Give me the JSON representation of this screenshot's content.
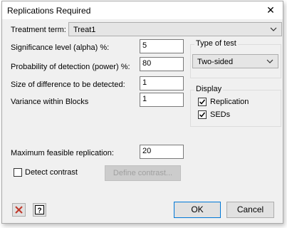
{
  "window": {
    "title": "Replications Required"
  },
  "treatment": {
    "label": "Treatment term:",
    "value": "Treat1"
  },
  "fields": {
    "alpha": {
      "label": "Significance level (alpha) %:",
      "value": "5"
    },
    "power": {
      "label": "Probability of detection (power) %:",
      "value": "80"
    },
    "difference": {
      "label": "Size of difference to be detected:",
      "value": "1"
    },
    "variance": {
      "label": "Variance within Blocks",
      "value": "1"
    },
    "max_rep": {
      "label": "Maximum feasible replication:",
      "value": "20"
    }
  },
  "test_type": {
    "group_label": "Type of test",
    "value": "Two-sided"
  },
  "display": {
    "group_label": "Display",
    "replication": {
      "label": "Replication",
      "checked": true
    },
    "seds": {
      "label": "SEDs",
      "checked": true
    }
  },
  "contrast": {
    "checkbox_label": "Detect contrast",
    "checked": false,
    "button_label": "Define contrast..."
  },
  "buttons": {
    "ok": "OK",
    "cancel": "Cancel"
  },
  "colors": {
    "accent": "#0078d7",
    "clear_icon": "#c0392b"
  }
}
